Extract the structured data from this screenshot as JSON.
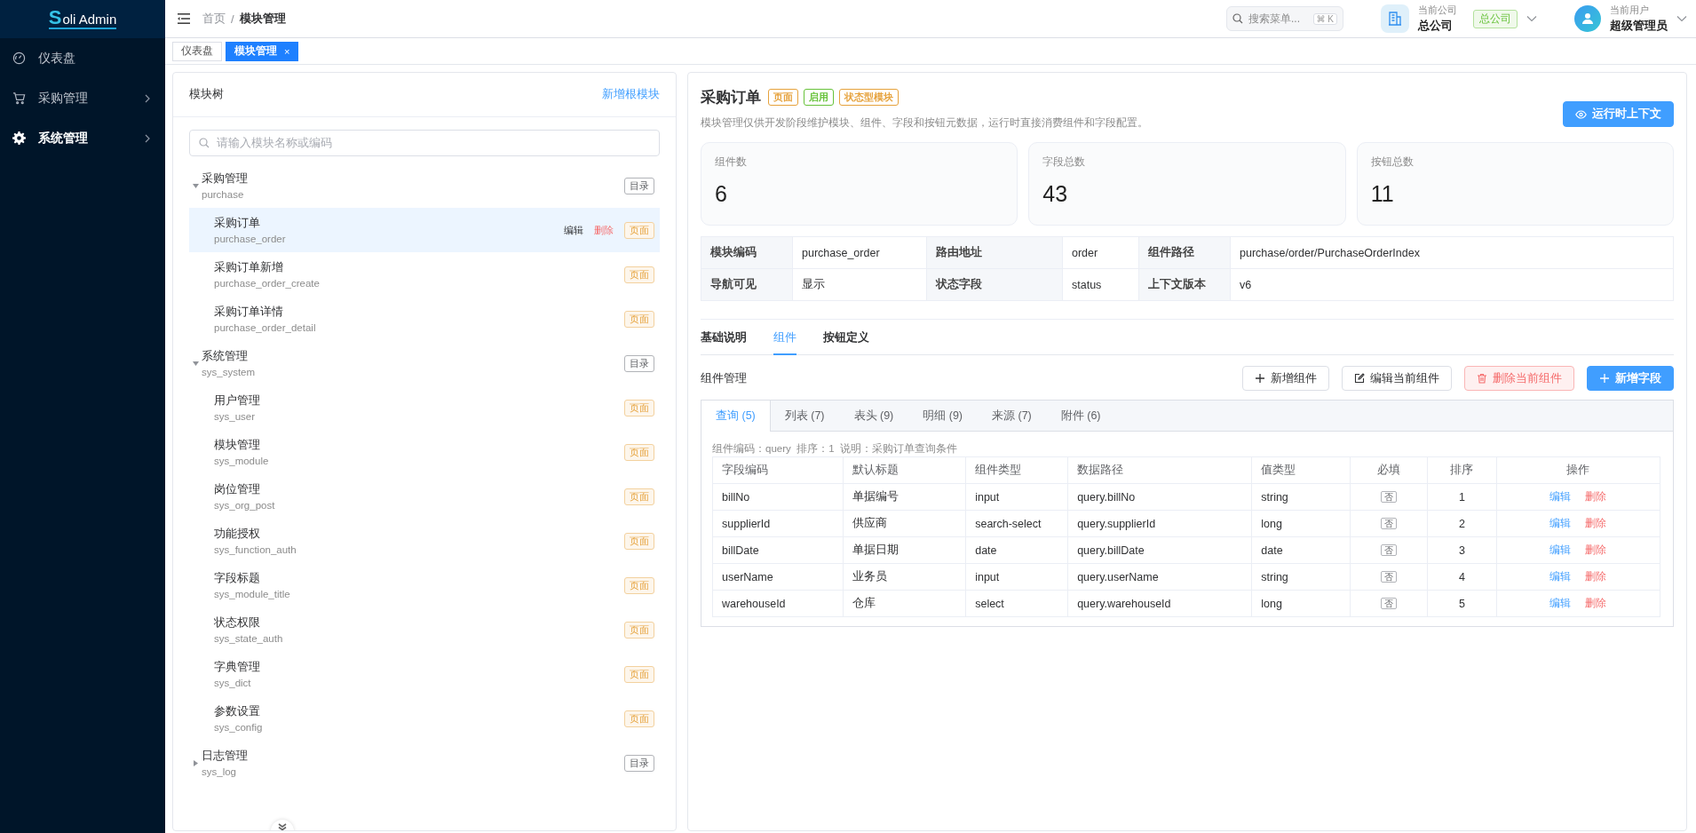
{
  "brand": {
    "mark": "S",
    "text": "oli Admin"
  },
  "sidebar": {
    "items": [
      {
        "label": "仪表盘",
        "has_children": false,
        "selected": false
      },
      {
        "label": "采购管理",
        "has_children": true,
        "selected": false
      },
      {
        "label": "系统管理",
        "has_children": true,
        "selected": true
      }
    ]
  },
  "header": {
    "breadcrumb": [
      "首页",
      "模块管理"
    ],
    "breadcrumb_separator": "/",
    "search": {
      "placeholder": "搜索菜单...",
      "shortcut": "⌘ K"
    },
    "company": {
      "label": "当前公司",
      "name": "总公司",
      "badge": "总公司"
    },
    "user": {
      "label": "当前用户",
      "name": "超级管理员"
    }
  },
  "page_tabs": [
    {
      "label": "仪表盘",
      "selected": false
    },
    {
      "label": "模块管理",
      "selected": true,
      "close": "×"
    }
  ],
  "tree": {
    "title": "模块树",
    "add_link": "新增根模块",
    "search": {
      "placeholder": "请输入模块名称或编码"
    },
    "nodes": [
      {
        "name": "采购管理",
        "code": "purchase",
        "tag": "目录",
        "kind": "dir",
        "expanded": true,
        "selected": false,
        "children": [
          {
            "name": "采购订单",
            "code": "purchase_order",
            "tag": "页面",
            "kind": "page",
            "selected": true,
            "actions": [
              "编辑",
              "删除"
            ]
          },
          {
            "name": "采购订单新增",
            "code": "purchase_order_create",
            "tag": "页面",
            "kind": "page",
            "selected": false
          },
          {
            "name": "采购订单详情",
            "code": "purchase_order_detail",
            "tag": "页面",
            "kind": "page",
            "selected": false
          }
        ]
      },
      {
        "name": "系统管理",
        "code": "sys_system",
        "tag": "目录",
        "kind": "dir",
        "expanded": true,
        "selected": false,
        "children": [
          {
            "name": "用户管理",
            "code": "sys_user",
            "tag": "页面",
            "kind": "page",
            "selected": false
          },
          {
            "name": "模块管理",
            "code": "sys_module",
            "tag": "页面",
            "kind": "page",
            "selected": false
          },
          {
            "name": "岗位管理",
            "code": "sys_org_post",
            "tag": "页面",
            "kind": "page",
            "selected": false
          },
          {
            "name": "功能授权",
            "code": "sys_function_auth",
            "tag": "页面",
            "kind": "page",
            "selected": false
          },
          {
            "name": "字段标题",
            "code": "sys_module_title",
            "tag": "页面",
            "kind": "page",
            "selected": false
          },
          {
            "name": "状态权限",
            "code": "sys_state_auth",
            "tag": "页面",
            "kind": "page",
            "selected": false
          },
          {
            "name": "字典管理",
            "code": "sys_dict",
            "tag": "页面",
            "kind": "page",
            "selected": false
          },
          {
            "name": "参数设置",
            "code": "sys_config",
            "tag": "页面",
            "kind": "page",
            "selected": false
          }
        ]
      },
      {
        "name": "日志管理",
        "code": "sys_log",
        "tag": "目录",
        "kind": "dir",
        "expanded": false,
        "selected": false
      }
    ]
  },
  "detail": {
    "title": "采购订单",
    "tags": [
      {
        "text": "页面",
        "color": "#e6a23c"
      },
      {
        "text": "启用",
        "color": "#67c23a"
      },
      {
        "text": "状态型模块",
        "color": "#e6a23c"
      }
    ],
    "description": "模块管理仅供开发阶段维护模块、组件、字段和按钮元数据，运行时直接消费组件和字段配置。",
    "context_button": "运行时上下文",
    "stats": [
      {
        "label": "组件数",
        "value": "6"
      },
      {
        "label": "字段总数",
        "value": "43"
      },
      {
        "label": "按钮总数",
        "value": "11"
      }
    ],
    "info": [
      [
        {
          "label": "模块编码",
          "value": "purchase_order"
        },
        {
          "label": "路由地址",
          "value": "order"
        },
        {
          "label": "组件路径",
          "value": "purchase/order/PurchaseOrderIndex"
        }
      ],
      [
        {
          "label": "导航可见",
          "value": "显示"
        },
        {
          "label": "状态字段",
          "value": "status"
        },
        {
          "label": "上下文版本",
          "value": "v6"
        }
      ]
    ],
    "tabs": [
      {
        "label": "基础说明",
        "selected": false
      },
      {
        "label": "组件",
        "selected": true
      },
      {
        "label": "按钮定义",
        "selected": false
      }
    ],
    "component_panel": {
      "title": "组件管理",
      "buttons": [
        {
          "label": "新增组件",
          "kind": "default"
        },
        {
          "label": "编辑当前组件",
          "kind": "default"
        },
        {
          "label": "删除当前组件",
          "kind": "danger"
        },
        {
          "label": "新增字段",
          "kind": "primary"
        }
      ],
      "tabs": [
        {
          "label": "查询 (5)",
          "selected": true
        },
        {
          "label": "列表 (7)",
          "selected": false
        },
        {
          "label": "表头 (9)",
          "selected": false
        },
        {
          "label": "明细 (9)",
          "selected": false
        },
        {
          "label": "来源 (7)",
          "selected": false
        },
        {
          "label": "附件 (6)",
          "selected": false
        }
      ],
      "meta": "组件编码：query  排序：1  说明：采购订单查询条件",
      "table": {
        "columns": [
          "字段编码",
          "默认标题",
          "组件类型",
          "数据路径",
          "值类型",
          "必填",
          "排序",
          "操作"
        ],
        "rows": [
          {
            "code": "billNo",
            "title": "单据编号",
            "type": "input",
            "path": "query.billNo",
            "value_type": "string",
            "required": "否",
            "order": "1",
            "actions": [
              "编辑",
              "删除"
            ]
          },
          {
            "code": "supplierId",
            "title": "供应商",
            "type": "search-select",
            "path": "query.supplierId",
            "value_type": "long",
            "required": "否",
            "order": "2",
            "actions": [
              "编辑",
              "删除"
            ]
          },
          {
            "code": "billDate",
            "title": "单据日期",
            "type": "date",
            "path": "query.billDate",
            "value_type": "date",
            "required": "否",
            "order": "3",
            "actions": [
              "编辑",
              "删除"
            ]
          },
          {
            "code": "userName",
            "title": "业务员",
            "type": "input",
            "path": "query.userName",
            "value_type": "string",
            "required": "否",
            "order": "4",
            "actions": [
              "编辑",
              "删除"
            ]
          },
          {
            "code": "warehouseId",
            "title": "仓库",
            "type": "select",
            "path": "query.warehouseId",
            "value_type": "long",
            "required": "否",
            "order": "5",
            "actions": [
              "编辑",
              "删除"
            ]
          }
        ]
      }
    }
  }
}
